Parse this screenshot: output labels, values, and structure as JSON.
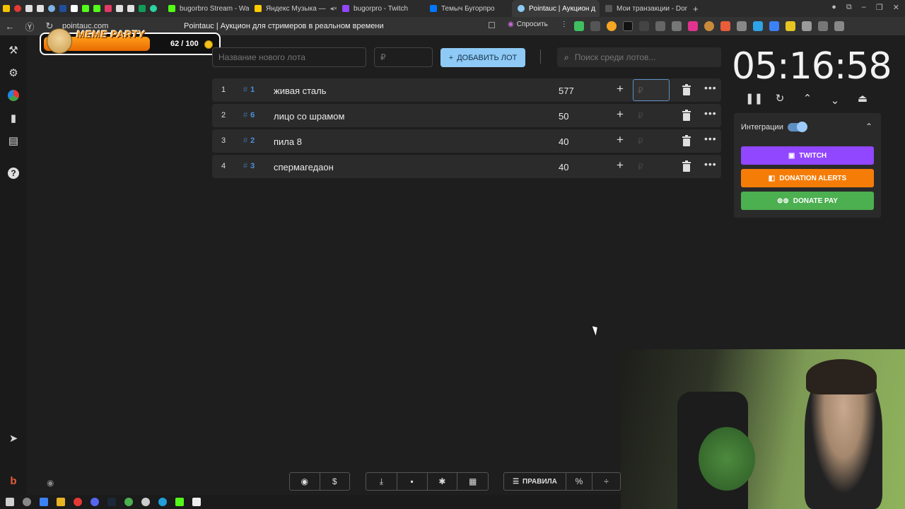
{
  "browser": {
    "tabs": [
      {
        "label": "bugorbro Stream - Wat",
        "color": "#53fc18"
      },
      {
        "label": "Яндекс Музыка —",
        "color": "#ffcc00"
      },
      {
        "label": "bugorpro - Twitch",
        "color": "#9146ff"
      },
      {
        "label": "Темыч Бугорпро",
        "color": "#0077ff"
      },
      {
        "label": "Pointauc | Аукцион д",
        "color": "#8ecaf5",
        "active": true
      },
      {
        "label": "Мои транзакции - Dona",
        "color": "#444444"
      }
    ],
    "url": "pointauc.com",
    "page_title": "Pointauc | Аукцион для стримеров в реальном времени",
    "ask_label": "Спросить"
  },
  "overlay": {
    "title": "MEME PARTY",
    "count": "62 / 100"
  },
  "lot_form": {
    "name_placeholder": "Название нового лота",
    "price_placeholder": "₽",
    "add_label": "ДОБАВИТЬ ЛОТ",
    "search_placeholder": "Поиск среди лотов..."
  },
  "lots": [
    {
      "index": "1",
      "id": "1",
      "name": "живая сталь",
      "amount": "577",
      "rub": "₽"
    },
    {
      "index": "2",
      "id": "6",
      "name": "лицо со шрамом",
      "amount": "50",
      "rub": "₽"
    },
    {
      "index": "3",
      "id": "2",
      "name": "пила 8",
      "amount": "40",
      "rub": "₽"
    },
    {
      "index": "4",
      "id": "3",
      "name": "спермагедаон",
      "amount": "40",
      "rub": "₽"
    }
  ],
  "timer": {
    "value": "05:16:58"
  },
  "integrations": {
    "title": "Интеграции",
    "enabled": true,
    "buttons": [
      {
        "label": "TWITCH",
        "color": "#9146ff"
      },
      {
        "label": "DONATION ALERTS",
        "color": "#f57d07"
      },
      {
        "label": "DONATE PAY",
        "color": "#4caf50"
      }
    ]
  },
  "toolbar": {
    "rules_label": "ПРАВИЛА"
  },
  "colors": {
    "accent": "#8ecaf5",
    "background": "#1e1e1e",
    "row": "#2b2b2b",
    "id_blue": "#4a90d9"
  }
}
